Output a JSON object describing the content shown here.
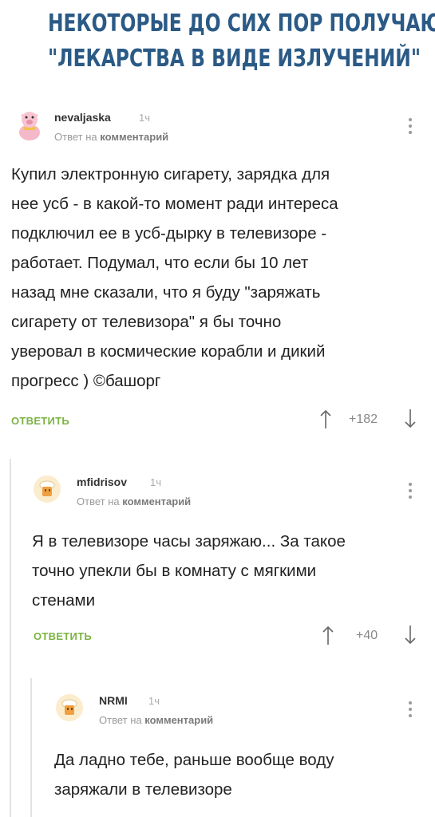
{
  "headline": {
    "line1": "НЕКОТОРЫЕ ДО СИХ ПОР ПОЛУЧАЮТ",
    "line2": "\"ЛЕКАРСТВА В ВИДЕ ИЗЛУЧЕНИЙ\""
  },
  "comments": [
    {
      "author": "nevaljaska",
      "time": "1ч",
      "reply_prefix": "Ответ на",
      "reply_target": "комментарий",
      "lines": [
        "Купил электронную сигарету, зарядка для",
        "нее усб - в какой-то момент ради интереса",
        "подключил ее в усб-дырку в телевизоре -",
        "работает. Подумал, что если бы 10 лет",
        "назад мне сказали, что я буду \"заряжать",
        "сигарету от телевизора\" я бы точно",
        "уверовал в космические корабли и дикий",
        "прогресс ) ©башорг"
      ],
      "reply_label": "ОТВЕТИТЬ",
      "rating": "+182"
    },
    {
      "author": "mfidrisov",
      "time": "1ч",
      "reply_prefix": "Ответ на",
      "reply_target": "комментарий",
      "lines": [
        "Я в телевизоре часы заряжаю... За такое",
        "точно упекли бы в комнату с мягкими",
        "стенами"
      ],
      "reply_label": "ОТВЕТИТЬ",
      "rating": "+40"
    },
    {
      "author": "NRMI",
      "time": "1ч",
      "reply_prefix": "Ответ на",
      "reply_target": "комментарий",
      "lines": [
        "Да ладно тебе, раньше вообще воду",
        "заряжали в телевизоре"
      ]
    }
  ],
  "colors": {
    "headline": "#2b5a86",
    "reply_button": "#7cb342",
    "thread_line": "#e2e2e2"
  },
  "icons": [
    "pig-avatar-icon",
    "chef-hat-avatar-icon",
    "kebab-menu-icon",
    "upvote-arrow-icon",
    "downvote-arrow-icon"
  ]
}
